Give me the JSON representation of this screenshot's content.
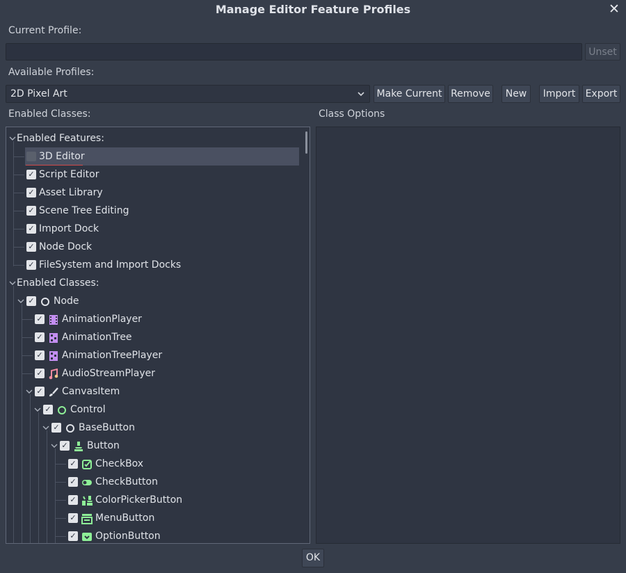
{
  "dialog": {
    "title": "Manage Editor Feature Profiles",
    "ok_label": "OK"
  },
  "current": {
    "label": "Current Profile:",
    "value": "",
    "unset_label": "Unset"
  },
  "available": {
    "label": "Available Profiles:",
    "selected": "2D Pixel Art",
    "buttons": {
      "make_current": "Make Current",
      "remove": "Remove",
      "new": "New",
      "import": "Import",
      "export": "Export"
    }
  },
  "enabled_classes_label": "Enabled Classes:",
  "class_options_label": "Class Options",
  "tree": {
    "features_header": "Enabled Features:",
    "features": [
      {
        "label": "3D Editor",
        "checked": false
      },
      {
        "label": "Script Editor",
        "checked": true
      },
      {
        "label": "Asset Library",
        "checked": true
      },
      {
        "label": "Scene Tree Editing",
        "checked": true
      },
      {
        "label": "Import Dock",
        "checked": true
      },
      {
        "label": "Node Dock",
        "checked": true
      },
      {
        "label": "FileSystem and Import Docks",
        "checked": true
      }
    ],
    "classes_header": "Enabled Classes:",
    "classes": [
      {
        "label": "Node",
        "icon": "node-circle-icon"
      },
      {
        "label": "AnimationPlayer",
        "icon": "animation-player-icon"
      },
      {
        "label": "AnimationTree",
        "icon": "animation-tree-icon"
      },
      {
        "label": "AnimationTreePlayer",
        "icon": "animation-tree-player-icon"
      },
      {
        "label": "AudioStreamPlayer",
        "icon": "audio-note-icon"
      },
      {
        "label": "CanvasItem",
        "icon": "brush-icon"
      },
      {
        "label": "Control",
        "icon": "control-circle-icon"
      },
      {
        "label": "BaseButton",
        "icon": "base-button-circle-icon"
      },
      {
        "label": "Button",
        "icon": "button-icon"
      },
      {
        "label": "CheckBox",
        "icon": "checkbox-icon"
      },
      {
        "label": "CheckButton",
        "icon": "toggle-icon"
      },
      {
        "label": "ColorPickerButton",
        "icon": "color-picker-icon"
      },
      {
        "label": "MenuButton",
        "icon": "menu-button-icon"
      },
      {
        "label": "OptionButton",
        "icon": "option-button-icon"
      }
    ]
  },
  "colors": {
    "accent_green": "#8eef97",
    "purple": "#c38ef1",
    "check_fill": "#e3e5e9"
  }
}
